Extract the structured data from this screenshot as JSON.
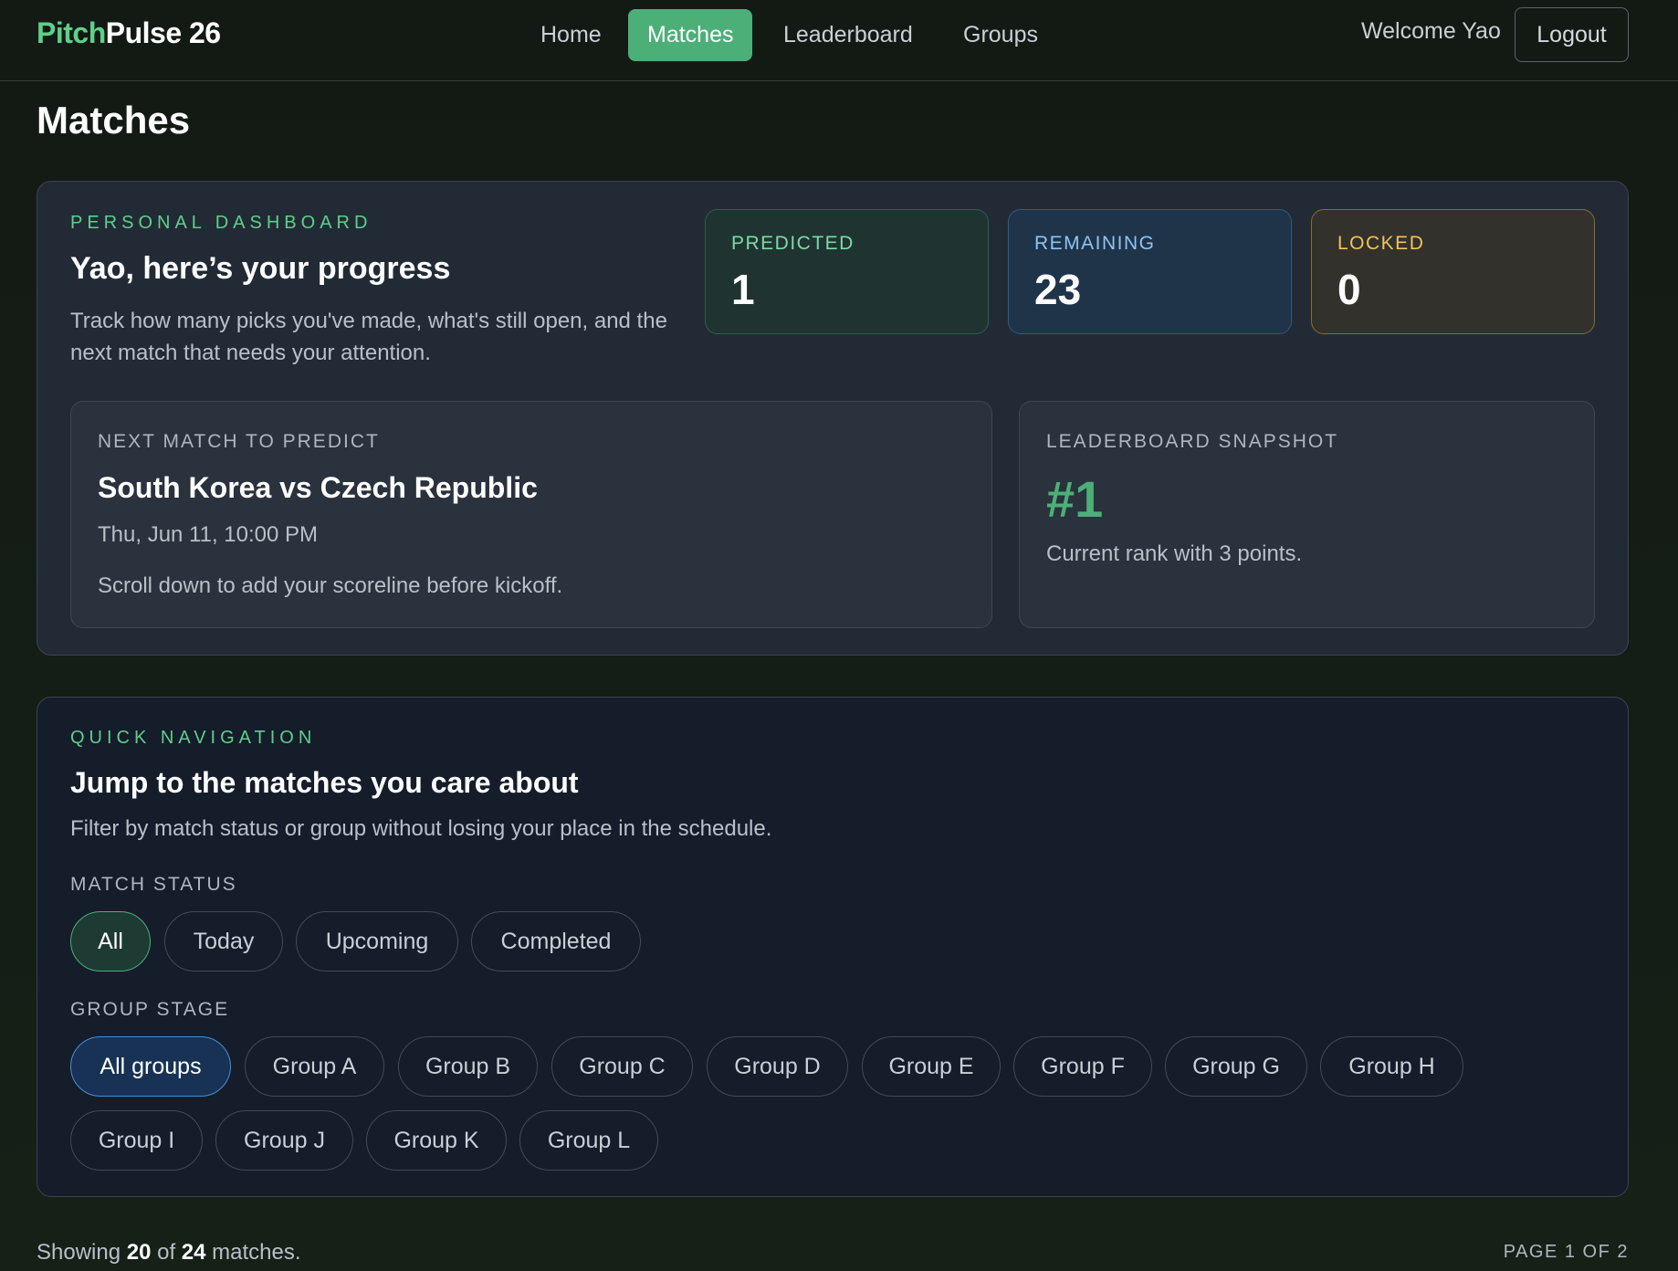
{
  "brand": {
    "part1": "Pitch",
    "part2": "Pulse 26"
  },
  "nav": {
    "items": [
      "Home",
      "Matches",
      "Leaderboard",
      "Groups"
    ],
    "active": "Matches"
  },
  "user": {
    "welcome": "Welcome Yao",
    "logout": "Logout"
  },
  "page_title": "Matches",
  "dashboard": {
    "eyebrow": "PERSONAL DASHBOARD",
    "title": "Yao, here’s your progress",
    "description": "Track how many picks you've made, what's still open, and the next match that needs your attention.",
    "stats": [
      {
        "label": "PREDICTED",
        "value": "1",
        "color": "#7fd9a6"
      },
      {
        "label": "REMAINING",
        "value": "23",
        "color": "#8cc4f2"
      },
      {
        "label": "LOCKED",
        "value": "0",
        "color": "#f0c35b"
      }
    ],
    "next_match": {
      "label": "NEXT MATCH TO PREDICT",
      "title": "South Korea vs Czech Republic",
      "datetime": "Thu, Jun 11, 10:00 PM",
      "note": "Scroll down to add your scoreline before kickoff."
    },
    "snapshot": {
      "label": "LEADERBOARD SNAPSHOT",
      "rank": "#1",
      "note": "Current rank with 3 points."
    }
  },
  "quick_nav": {
    "eyebrow": "QUICK NAVIGATION",
    "title": "Jump to the matches you care about",
    "description": "Filter by match status or group without losing your place in the schedule.",
    "status_label": "MATCH STATUS",
    "status_options": [
      "All",
      "Today",
      "Upcoming",
      "Completed"
    ],
    "status_selected": "All",
    "group_label": "GROUP STAGE",
    "group_options": [
      "All groups",
      "Group A",
      "Group B",
      "Group C",
      "Group D",
      "Group E",
      "Group F",
      "Group G",
      "Group H",
      "Group I",
      "Group J",
      "Group K",
      "Group L"
    ],
    "group_selected": "All groups"
  },
  "footer": {
    "showing_prefix": "Showing",
    "showing_count": "20",
    "of": "of",
    "total": "24",
    "suffix": "matches.",
    "page": "PAGE 1 OF 2"
  },
  "colors": {
    "accent": "#4caf78",
    "brand_green": "#5fcf8a",
    "group_selected": "#4a8fd6"
  }
}
